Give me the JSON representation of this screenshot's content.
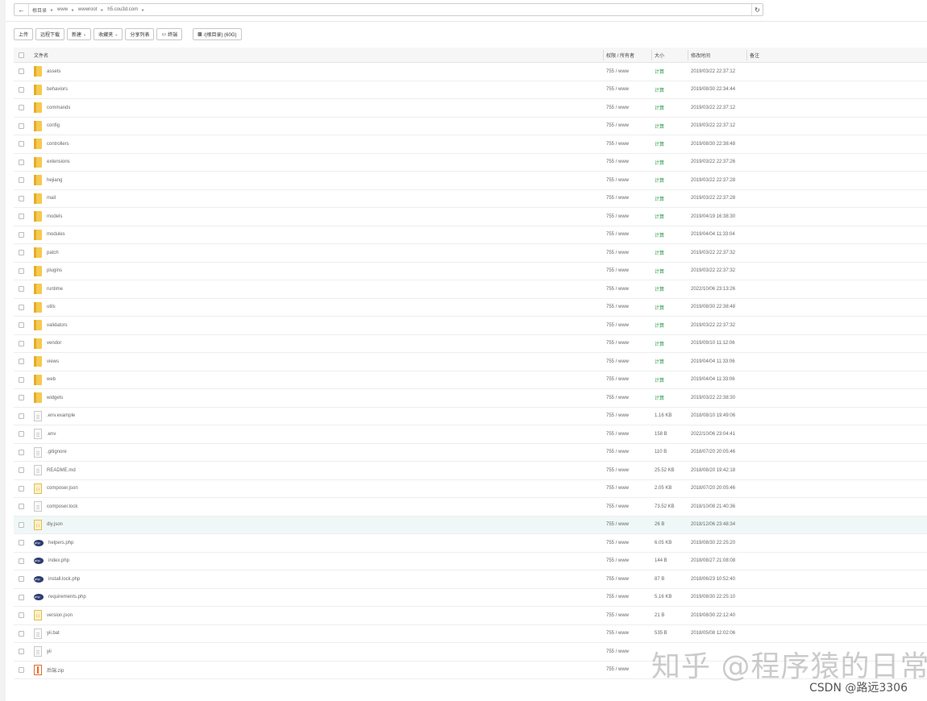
{
  "path_bar": {
    "crumbs": [
      "根目录",
      "www",
      "wwwroot",
      "h5.cou3d.com"
    ],
    "back_icon": "arrow-left-icon",
    "refresh_icon": "refresh-icon"
  },
  "toolbar": {
    "upload": "上传",
    "remote_download": "远程下载",
    "new": "新建",
    "favorites": "收藏夹",
    "share_list": "分享列表",
    "terminal": "终端",
    "disk": "/(根目录) (60G)"
  },
  "table": {
    "headers": {
      "name": "文件名",
      "perm": "权限 / 所有者",
      "size": "大小",
      "mtime": "修改时间",
      "note": "备注"
    },
    "rows": [
      {
        "type": "folder",
        "name": "assets",
        "perm": "755 / www",
        "size": "计算",
        "mtime": "2019/03/22 22:37:12"
      },
      {
        "type": "folder",
        "name": "behaviors",
        "perm": "755 / www",
        "size": "计算",
        "mtime": "2019/08/30 22:34:44"
      },
      {
        "type": "folder",
        "name": "commands",
        "perm": "755 / www",
        "size": "计算",
        "mtime": "2019/03/22 22:37:12"
      },
      {
        "type": "folder",
        "name": "config",
        "perm": "755 / www",
        "size": "计算",
        "mtime": "2019/03/22 22:37:12"
      },
      {
        "type": "folder",
        "name": "controllers",
        "perm": "755 / www",
        "size": "计算",
        "mtime": "2019/08/30 22:38:48"
      },
      {
        "type": "folder",
        "name": "extensions",
        "perm": "755 / www",
        "size": "计算",
        "mtime": "2019/03/22 22:37:26"
      },
      {
        "type": "folder",
        "name": "hejiang",
        "perm": "755 / www",
        "size": "计算",
        "mtime": "2019/03/22 22:37:28"
      },
      {
        "type": "folder",
        "name": "mail",
        "perm": "755 / www",
        "size": "计算",
        "mtime": "2019/03/22 22:37:28"
      },
      {
        "type": "folder",
        "name": "models",
        "perm": "755 / www",
        "size": "计算",
        "mtime": "2019/04/19 16:38:30"
      },
      {
        "type": "folder",
        "name": "modules",
        "perm": "755 / www",
        "size": "计算",
        "mtime": "2019/04/04 11:33:04"
      },
      {
        "type": "folder",
        "name": "patch",
        "perm": "755 / www",
        "size": "计算",
        "mtime": "2019/03/22 22:37:32"
      },
      {
        "type": "folder",
        "name": "plugins",
        "perm": "755 / www",
        "size": "计算",
        "mtime": "2019/03/22 22:37:32"
      },
      {
        "type": "folder",
        "name": "runtime",
        "perm": "755 / www",
        "size": "计算",
        "mtime": "2022/10/06 23:13:26"
      },
      {
        "type": "folder",
        "name": "utils",
        "perm": "755 / www",
        "size": "计算",
        "mtime": "2019/08/30 22:38:48"
      },
      {
        "type": "folder",
        "name": "validators",
        "perm": "755 / www",
        "size": "计算",
        "mtime": "2019/03/22 22:37:32"
      },
      {
        "type": "folder",
        "name": "vendor",
        "perm": "755 / www",
        "size": "计算",
        "mtime": "2019/09/10 11:12:06"
      },
      {
        "type": "folder",
        "name": "views",
        "perm": "755 / www",
        "size": "计算",
        "mtime": "2019/04/04 11:33:06"
      },
      {
        "type": "folder",
        "name": "web",
        "perm": "755 / www",
        "size": "计算",
        "mtime": "2019/04/04 11:33:06"
      },
      {
        "type": "folder",
        "name": "widgets",
        "perm": "755 / www",
        "size": "计算",
        "mtime": "2019/03/22 22:38:30"
      },
      {
        "type": "file",
        "name": ".env.example",
        "perm": "755 / www",
        "size": "1.16 KB",
        "mtime": "2018/08/10 19:49:06"
      },
      {
        "type": "file",
        "name": ".env",
        "perm": "755 / www",
        "size": "158 B",
        "mtime": "2022/10/06 23:04:41"
      },
      {
        "type": "file",
        "name": ".gitignore",
        "perm": "755 / www",
        "size": "110 B",
        "mtime": "2018/07/20 20:05:46"
      },
      {
        "type": "file",
        "name": "README.md",
        "perm": "755 / www",
        "size": "25.52 KB",
        "mtime": "2018/08/20 19:42:18"
      },
      {
        "type": "json",
        "name": "composer.json",
        "perm": "755 / www",
        "size": "2.05 KB",
        "mtime": "2018/07/20 20:05:46"
      },
      {
        "type": "file",
        "name": "composer.lock",
        "perm": "755 / www",
        "size": "73.52 KB",
        "mtime": "2018/10/08 21:40:36"
      },
      {
        "type": "json",
        "name": "diy.json",
        "perm": "755 / www",
        "size": "26 B",
        "mtime": "2018/12/06 23:48:34",
        "highlight": true
      },
      {
        "type": "php",
        "name": "helpers.php",
        "perm": "755 / www",
        "size": "6.05 KB",
        "mtime": "2019/08/30 22:25:20"
      },
      {
        "type": "php",
        "name": "index.php",
        "perm": "755 / www",
        "size": "144 B",
        "mtime": "2018/08/27 21:08:08"
      },
      {
        "type": "php",
        "name": "install.lock.php",
        "perm": "755 / www",
        "size": "87 B",
        "mtime": "2018/06/23 10:52:40"
      },
      {
        "type": "php",
        "name": "requirements.php",
        "perm": "755 / www",
        "size": "5.16 KB",
        "mtime": "2019/08/30 22:25:10"
      },
      {
        "type": "json",
        "name": "version.json",
        "perm": "755 / www",
        "size": "21 B",
        "mtime": "2019/08/30 22:12:40"
      },
      {
        "type": "file",
        "name": "yii.bat",
        "perm": "755 / www",
        "size": "535 B",
        "mtime": "2018/05/08 12:02:06"
      },
      {
        "type": "file",
        "name": "yii",
        "perm": "755 / www",
        "size": "",
        "mtime": ""
      },
      {
        "type": "zip",
        "name": "后端.zip",
        "perm": "755 / www",
        "size": "",
        "mtime": ""
      }
    ]
  },
  "watermark": "知乎 @程序猿的日常",
  "csdn_mark": "CSDN @路远3306"
}
